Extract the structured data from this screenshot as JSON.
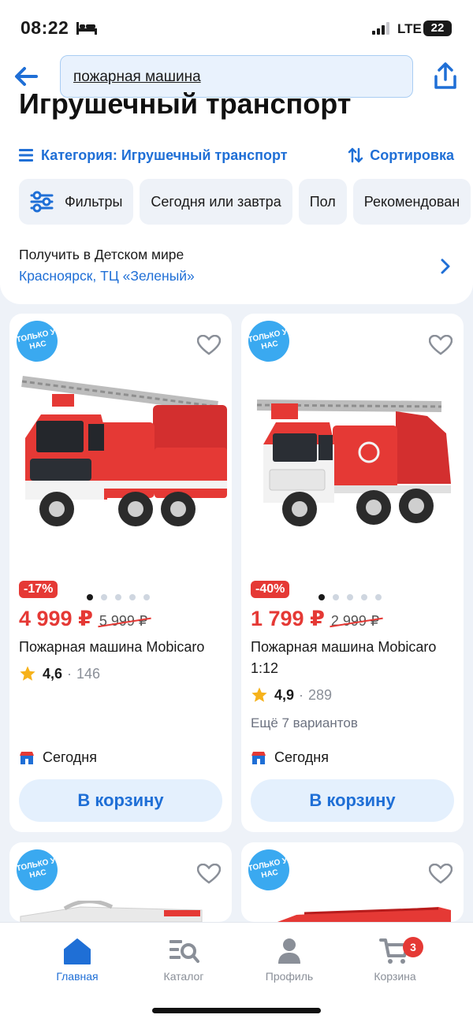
{
  "status_bar": {
    "time": "08:22",
    "network": "LTE",
    "battery": "22"
  },
  "header": {
    "search_value": "пожарная машина",
    "title": "Игрушечный транспорт"
  },
  "category": {
    "label": "Категория: Игрушечный транспорт",
    "sort_label": "Сортировка"
  },
  "chips": [
    "Фильтры",
    "Сегодня или завтра",
    "Пол",
    "Рекомендован"
  ],
  "pickup": {
    "title": "Получить в Детском мире",
    "place": "Красноярск, ТЦ «Зеленый»"
  },
  "products": [
    {
      "badge": "ТОЛЬКО У НАС",
      "discount": "-17%",
      "price": "4 999 ₽",
      "old_price": "5 999 ₽",
      "name": "Пожарная машина Mobicaro",
      "rating": "4,6",
      "reviews": "146",
      "variants": "",
      "delivery": "Сегодня",
      "cart_label": "В корзину"
    },
    {
      "badge": "ТОЛЬКО У НАС",
      "discount": "-40%",
      "price": "1 799 ₽",
      "old_price": "2 999 ₽",
      "name": "Пожарная машина Mobicaro 1:12",
      "rating": "4,9",
      "reviews": "289",
      "variants": "Ещё 7 вариантов",
      "delivery": "Сегодня",
      "cart_label": "В корзину"
    },
    {
      "badge": "ТОЛЬКО У НАС"
    },
    {
      "badge": "ТОЛЬКО У НАС"
    }
  ],
  "tabbar": {
    "home": "Главная",
    "catalog": "Каталог",
    "profile": "Профиль",
    "cart": "Корзина",
    "cart_count": "3"
  },
  "colors": {
    "accent": "#1f6fd6",
    "sale": "#e53935",
    "badge": "#3aa9f0"
  }
}
